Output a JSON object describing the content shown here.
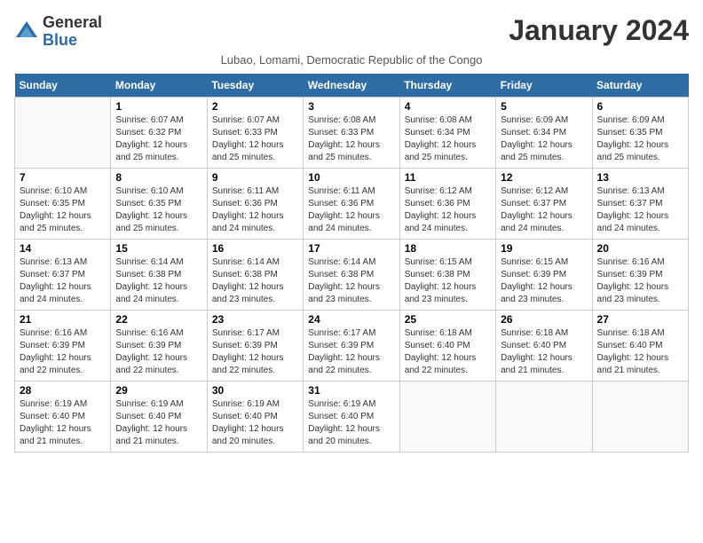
{
  "header": {
    "logo_line1": "General",
    "logo_line2": "Blue",
    "month_title": "January 2024",
    "subtitle": "Lubao, Lomami, Democratic Republic of the Congo"
  },
  "days_of_week": [
    "Sunday",
    "Monday",
    "Tuesday",
    "Wednesday",
    "Thursday",
    "Friday",
    "Saturday"
  ],
  "weeks": [
    [
      {
        "day": "",
        "sunrise": "",
        "sunset": "",
        "daylight": ""
      },
      {
        "day": "1",
        "sunrise": "Sunrise: 6:07 AM",
        "sunset": "Sunset: 6:32 PM",
        "daylight": "Daylight: 12 hours and 25 minutes."
      },
      {
        "day": "2",
        "sunrise": "Sunrise: 6:07 AM",
        "sunset": "Sunset: 6:33 PM",
        "daylight": "Daylight: 12 hours and 25 minutes."
      },
      {
        "day": "3",
        "sunrise": "Sunrise: 6:08 AM",
        "sunset": "Sunset: 6:33 PM",
        "daylight": "Daylight: 12 hours and 25 minutes."
      },
      {
        "day": "4",
        "sunrise": "Sunrise: 6:08 AM",
        "sunset": "Sunset: 6:34 PM",
        "daylight": "Daylight: 12 hours and 25 minutes."
      },
      {
        "day": "5",
        "sunrise": "Sunrise: 6:09 AM",
        "sunset": "Sunset: 6:34 PM",
        "daylight": "Daylight: 12 hours and 25 minutes."
      },
      {
        "day": "6",
        "sunrise": "Sunrise: 6:09 AM",
        "sunset": "Sunset: 6:35 PM",
        "daylight": "Daylight: 12 hours and 25 minutes."
      }
    ],
    [
      {
        "day": "7",
        "sunrise": "Sunrise: 6:10 AM",
        "sunset": "Sunset: 6:35 PM",
        "daylight": "Daylight: 12 hours and 25 minutes."
      },
      {
        "day": "8",
        "sunrise": "Sunrise: 6:10 AM",
        "sunset": "Sunset: 6:35 PM",
        "daylight": "Daylight: 12 hours and 25 minutes."
      },
      {
        "day": "9",
        "sunrise": "Sunrise: 6:11 AM",
        "sunset": "Sunset: 6:36 PM",
        "daylight": "Daylight: 12 hours and 24 minutes."
      },
      {
        "day": "10",
        "sunrise": "Sunrise: 6:11 AM",
        "sunset": "Sunset: 6:36 PM",
        "daylight": "Daylight: 12 hours and 24 minutes."
      },
      {
        "day": "11",
        "sunrise": "Sunrise: 6:12 AM",
        "sunset": "Sunset: 6:36 PM",
        "daylight": "Daylight: 12 hours and 24 minutes."
      },
      {
        "day": "12",
        "sunrise": "Sunrise: 6:12 AM",
        "sunset": "Sunset: 6:37 PM",
        "daylight": "Daylight: 12 hours and 24 minutes."
      },
      {
        "day": "13",
        "sunrise": "Sunrise: 6:13 AM",
        "sunset": "Sunset: 6:37 PM",
        "daylight": "Daylight: 12 hours and 24 minutes."
      }
    ],
    [
      {
        "day": "14",
        "sunrise": "Sunrise: 6:13 AM",
        "sunset": "Sunset: 6:37 PM",
        "daylight": "Daylight: 12 hours and 24 minutes."
      },
      {
        "day": "15",
        "sunrise": "Sunrise: 6:14 AM",
        "sunset": "Sunset: 6:38 PM",
        "daylight": "Daylight: 12 hours and 24 minutes."
      },
      {
        "day": "16",
        "sunrise": "Sunrise: 6:14 AM",
        "sunset": "Sunset: 6:38 PM",
        "daylight": "Daylight: 12 hours and 23 minutes."
      },
      {
        "day": "17",
        "sunrise": "Sunrise: 6:14 AM",
        "sunset": "Sunset: 6:38 PM",
        "daylight": "Daylight: 12 hours and 23 minutes."
      },
      {
        "day": "18",
        "sunrise": "Sunrise: 6:15 AM",
        "sunset": "Sunset: 6:38 PM",
        "daylight": "Daylight: 12 hours and 23 minutes."
      },
      {
        "day": "19",
        "sunrise": "Sunrise: 6:15 AM",
        "sunset": "Sunset: 6:39 PM",
        "daylight": "Daylight: 12 hours and 23 minutes."
      },
      {
        "day": "20",
        "sunrise": "Sunrise: 6:16 AM",
        "sunset": "Sunset: 6:39 PM",
        "daylight": "Daylight: 12 hours and 23 minutes."
      }
    ],
    [
      {
        "day": "21",
        "sunrise": "Sunrise: 6:16 AM",
        "sunset": "Sunset: 6:39 PM",
        "daylight": "Daylight: 12 hours and 22 minutes."
      },
      {
        "day": "22",
        "sunrise": "Sunrise: 6:16 AM",
        "sunset": "Sunset: 6:39 PM",
        "daylight": "Daylight: 12 hours and 22 minutes."
      },
      {
        "day": "23",
        "sunrise": "Sunrise: 6:17 AM",
        "sunset": "Sunset: 6:39 PM",
        "daylight": "Daylight: 12 hours and 22 minutes."
      },
      {
        "day": "24",
        "sunrise": "Sunrise: 6:17 AM",
        "sunset": "Sunset: 6:39 PM",
        "daylight": "Daylight: 12 hours and 22 minutes."
      },
      {
        "day": "25",
        "sunrise": "Sunrise: 6:18 AM",
        "sunset": "Sunset: 6:40 PM",
        "daylight": "Daylight: 12 hours and 22 minutes."
      },
      {
        "day": "26",
        "sunrise": "Sunrise: 6:18 AM",
        "sunset": "Sunset: 6:40 PM",
        "daylight": "Daylight: 12 hours and 21 minutes."
      },
      {
        "day": "27",
        "sunrise": "Sunrise: 6:18 AM",
        "sunset": "Sunset: 6:40 PM",
        "daylight": "Daylight: 12 hours and 21 minutes."
      }
    ],
    [
      {
        "day": "28",
        "sunrise": "Sunrise: 6:19 AM",
        "sunset": "Sunset: 6:40 PM",
        "daylight": "Daylight: 12 hours and 21 minutes."
      },
      {
        "day": "29",
        "sunrise": "Sunrise: 6:19 AM",
        "sunset": "Sunset: 6:40 PM",
        "daylight": "Daylight: 12 hours and 21 minutes."
      },
      {
        "day": "30",
        "sunrise": "Sunrise: 6:19 AM",
        "sunset": "Sunset: 6:40 PM",
        "daylight": "Daylight: 12 hours and 20 minutes."
      },
      {
        "day": "31",
        "sunrise": "Sunrise: 6:19 AM",
        "sunset": "Sunset: 6:40 PM",
        "daylight": "Daylight: 12 hours and 20 minutes."
      },
      {
        "day": "",
        "sunrise": "",
        "sunset": "",
        "daylight": ""
      },
      {
        "day": "",
        "sunrise": "",
        "sunset": "",
        "daylight": ""
      },
      {
        "day": "",
        "sunrise": "",
        "sunset": "",
        "daylight": ""
      }
    ]
  ]
}
